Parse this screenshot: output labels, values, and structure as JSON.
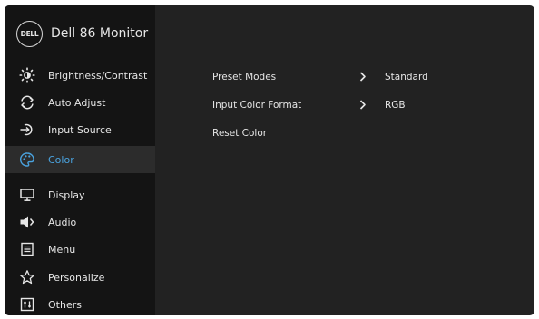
{
  "header": {
    "logo_text": "DELL",
    "model": "Dell 86 Monitor"
  },
  "sidebar": {
    "items": [
      {
        "label": "Brightness/Contrast",
        "icon": "brightness-icon"
      },
      {
        "label": "Auto Adjust",
        "icon": "auto-adjust-icon"
      },
      {
        "label": "Input Source",
        "icon": "input-source-icon"
      },
      {
        "label": "Color",
        "icon": "color-palette-icon",
        "active": true
      },
      {
        "label": "Display",
        "icon": "display-icon"
      },
      {
        "label": "Audio",
        "icon": "speaker-icon"
      },
      {
        "label": "Menu",
        "icon": "menu-icon"
      },
      {
        "label": "Personalize",
        "icon": "star-icon"
      },
      {
        "label": "Others",
        "icon": "others-icon"
      }
    ]
  },
  "content": {
    "rows": [
      {
        "name": "Preset Modes",
        "chevron": "›",
        "value": "Standard"
      },
      {
        "name": "Input Color Format",
        "chevron": "›",
        "value": "RGB"
      },
      {
        "name": "Reset Color"
      }
    ]
  },
  "colors": {
    "accent": "#4aa3df",
    "sidebar_bg": "#141414",
    "panel_bg": "#222222",
    "active_bg": "#2c2c2c",
    "text": "#e6e6e6"
  }
}
